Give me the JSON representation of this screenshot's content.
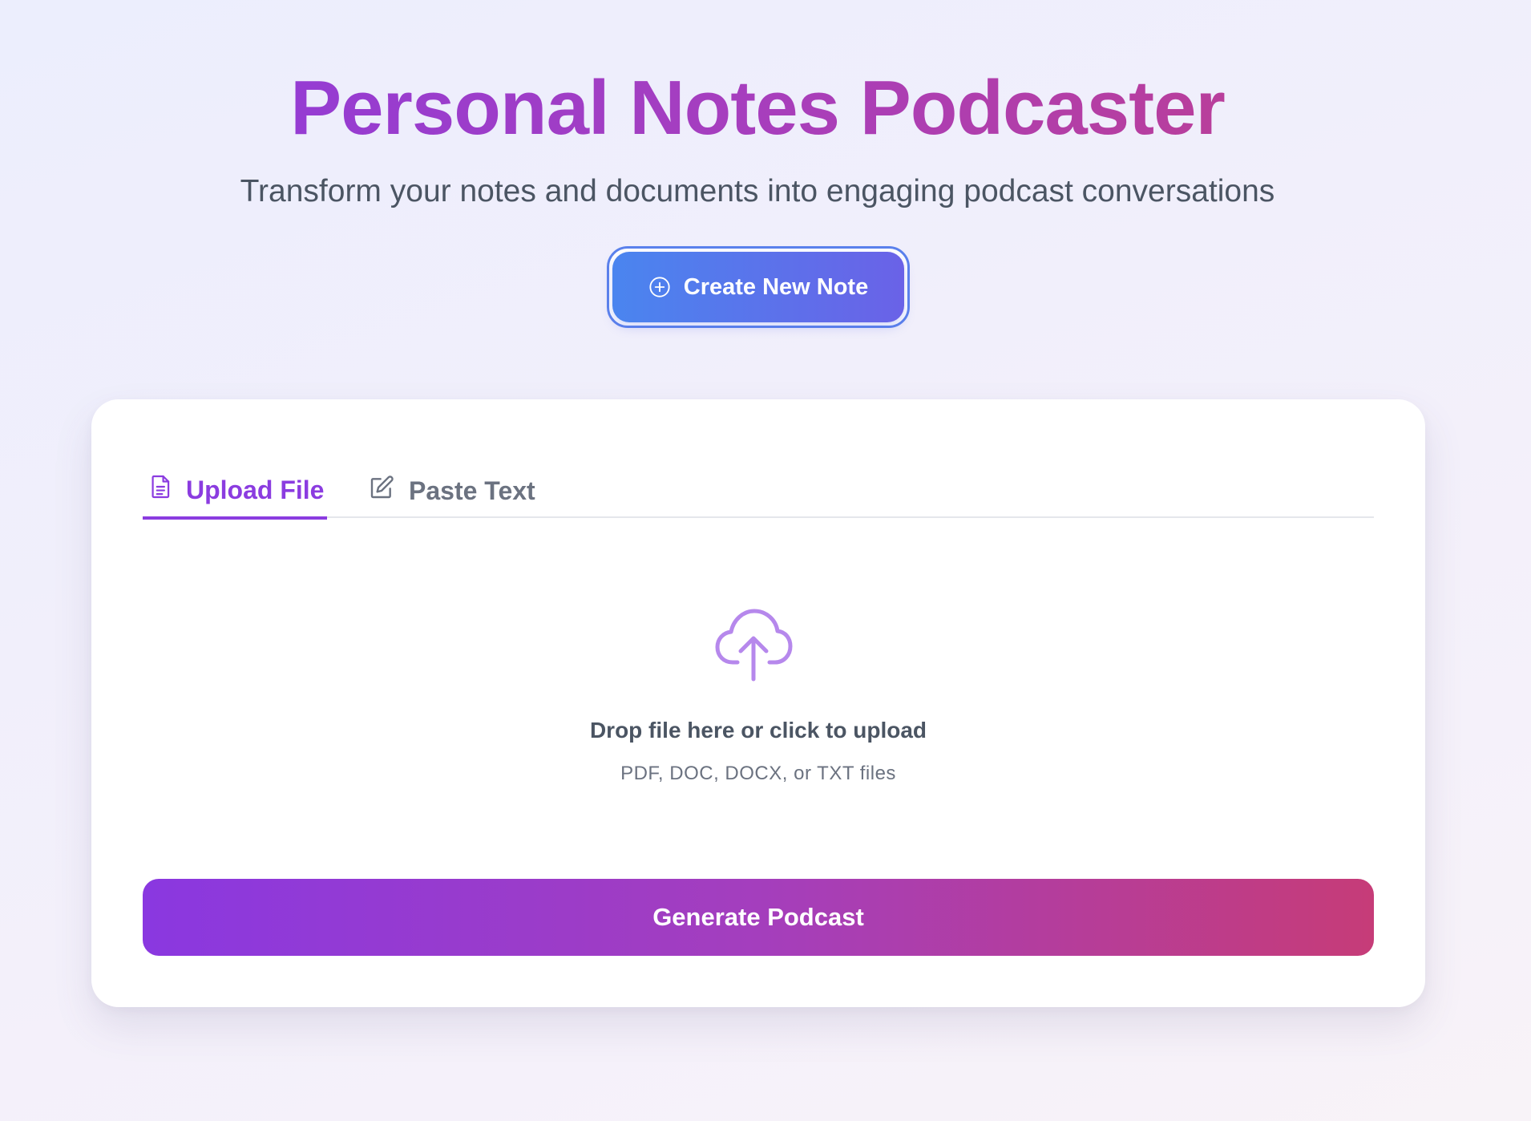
{
  "header": {
    "title": "Personal Notes Podcaster",
    "subtitle": "Transform your notes and documents into engaging podcast conversations"
  },
  "create_button": {
    "label": "Create New Note",
    "icon": "plus-circle-icon"
  },
  "tabs": [
    {
      "label": "Upload File",
      "icon": "document-icon",
      "active": true
    },
    {
      "label": "Paste Text",
      "icon": "edit-icon",
      "active": false
    }
  ],
  "dropzone": {
    "icon": "cloud-upload-icon",
    "title": "Drop file here or click to upload",
    "subtitle": "PDF, DOC, DOCX, or TXT files"
  },
  "generate_button": {
    "label": "Generate Podcast"
  },
  "colors": {
    "accent_purple": "#8b3ce0",
    "accent_pink": "#c63c78",
    "accent_blue": "#4a85ef",
    "text_muted": "#6b7280"
  }
}
